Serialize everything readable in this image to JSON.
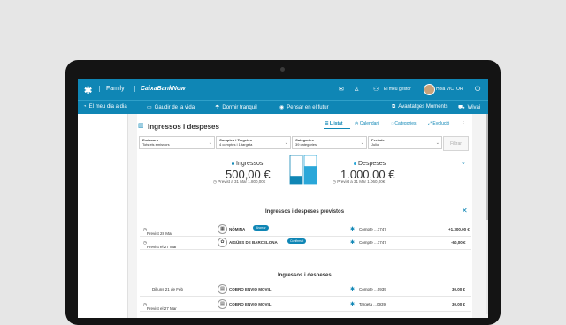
{
  "topbar": {
    "logo": "✱",
    "family": "Family",
    "brand": "CaixaBankNow",
    "gestor": "El meu gestor",
    "hola": "Hola VICTOR"
  },
  "nav": {
    "items": [
      {
        "icon": "coffee-icon",
        "label": "El meu dia a dia"
      },
      {
        "icon": "picture-icon",
        "label": "Gaudir de la vida"
      },
      {
        "icon": "umbrella-icon",
        "label": "Dormir tranquil"
      },
      {
        "icon": "piggy-icon",
        "label": "Pensar en el futur"
      },
      {
        "icon": "moments-icon",
        "label": "Avantatges Moments"
      },
      {
        "icon": "cart-icon",
        "label": "Wivai"
      }
    ]
  },
  "page": {
    "title": "Ingressos i despeses",
    "tabs": [
      "Llistat",
      "Calendari",
      "Categories",
      "Evolució"
    ]
  },
  "filters": [
    {
      "label": "Emissors",
      "value": "Tots els emissors"
    },
    {
      "label": "Comptes i Targetes",
      "value": "4 comptes i 1 targeta"
    },
    {
      "label": "Categories",
      "value": "39 categories"
    },
    {
      "label": "Període",
      "value": "Juliol"
    }
  ],
  "filter_button": "Filtrar",
  "summary": {
    "income": {
      "label": "Ingressos",
      "amount": "500,00 €",
      "forecast": "Previst a 31 Mar 1.800,00€",
      "color": "#0f86b5"
    },
    "expenses": {
      "label": "Despeses",
      "amount": "1.000,00 €",
      "forecast": "Previst a 31 Mar 1.060,00€",
      "color": "#2aa7d9"
    },
    "bar_income_fraction": 0.5,
    "bar_expense_fraction": 1.0
  },
  "forecast_section": {
    "title": "Ingressos i despeses previstos",
    "rows": [
      {
        "date": "Previst 28 Mar",
        "name": "NÓMINA",
        "badge": "Ahorrar",
        "account": "Compte ...1747",
        "amount": "+1.300,00 €"
      },
      {
        "date": "Previst el 27 Mar",
        "name": "AIGÜES DE BARCELONA",
        "badge": "Confirmat",
        "account": "Compte ...1747",
        "amount": "-60,00 €"
      }
    ]
  },
  "movements_section": {
    "title": "Ingressos i despeses",
    "rows": [
      {
        "date": "Dilluns 21 de Feb",
        "name": "COBRO ENVIO MOVIL",
        "account": "Compte ...0939",
        "amount": "30,00 €"
      },
      {
        "date": "Previst el 27 Mar",
        "name": "COBRO ENVIO MOVIL",
        "account": "Targeta ...0939",
        "amount": "30,00 €"
      }
    ]
  }
}
